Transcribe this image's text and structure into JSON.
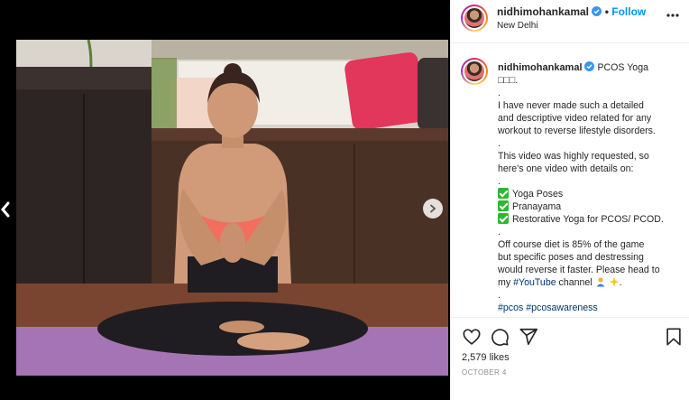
{
  "post": {
    "username": "nidhimohankamal",
    "follow_label": "Follow",
    "separator": "•",
    "location": "New Delhi",
    "more_icon": "more-options-icon"
  },
  "caption": {
    "username": "nidhimohankamal",
    "title": "PCOS Yoga",
    "title_suffix": "□□□.",
    "lines": [
      ".",
      "I have never made such a detailed",
      "and descriptive video related for any",
      "workout to reverse lifestyle disorders.",
      ".",
      "This video was highly requested, so",
      "here's one video with details on:",
      "."
    ],
    "checklist": [
      "Yoga Poses",
      "Pranayama",
      "Restorative Yoga for PCOS/ PCOD."
    ],
    "lines2": [
      ".",
      "Off course diet is 85% of the game",
      "but specific poses and destressing",
      "would reverse it faster. Please head to"
    ],
    "line_link_prefix": "my ",
    "youtube_link": "#YouTube",
    "line_link_suffix": " channel",
    "emoji_tail": ".",
    "dot_after": ".",
    "hashtags": [
      "#pcos",
      "#pcosawareness"
    ]
  },
  "actions": {
    "like_icon": "heart-icon",
    "comment_icon": "comment-icon",
    "share_icon": "share-icon",
    "save_icon": "bookmark-icon"
  },
  "likes_text": "2,579 likes",
  "date_text": "OCTOBER 4",
  "colors": {
    "accent": "#0095f6",
    "link": "#00376b",
    "verified": "#3897f0",
    "check": "#2eb82e"
  }
}
